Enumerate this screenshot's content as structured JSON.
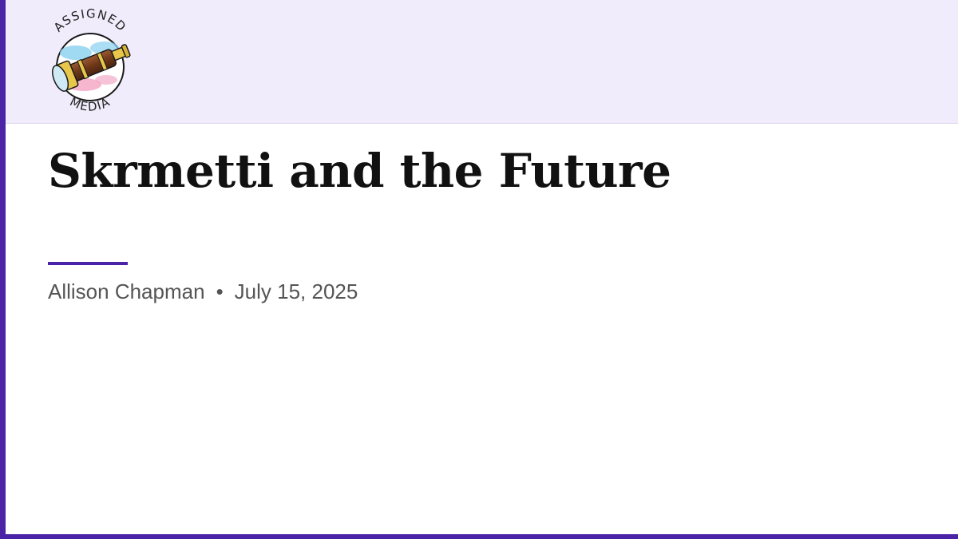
{
  "brand": {
    "logo_top_text": "ASSIGNED",
    "logo_bottom_text": "MEDIA",
    "logo_icon": "spyglass-icon",
    "accent_color": "#4a23a6",
    "header_bg": "#f1ecfb"
  },
  "article": {
    "title": "Skrmetti and the Future",
    "author": "Allison Chapman",
    "separator": "•",
    "date": "July 15, 2025"
  }
}
